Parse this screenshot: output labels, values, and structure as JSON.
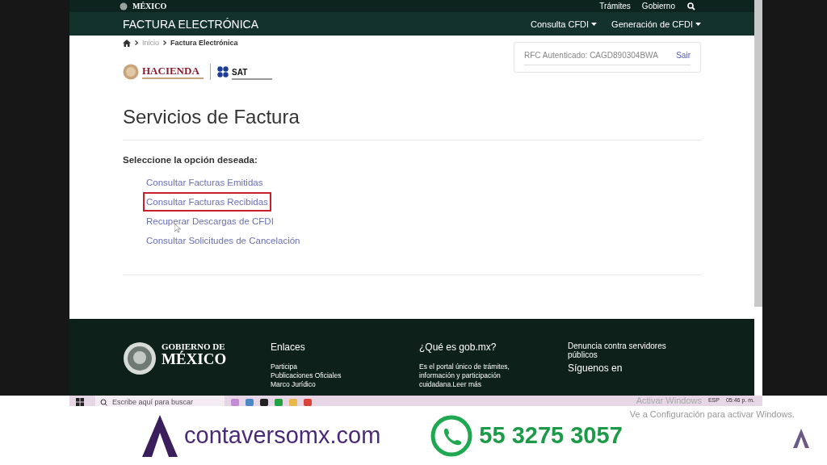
{
  "top_bar": {
    "logo": "MÉXICO",
    "links": [
      "Trámites",
      "Gobierno"
    ]
  },
  "nav_bar": {
    "title": "FACTURA ELECTRÓNICA",
    "menus": [
      "Consulta CFDI",
      "Generación de CFDI"
    ]
  },
  "breadcrumb": [
    "Inicio",
    "Factura Electrónica"
  ],
  "session": {
    "rfc": "RFC Autenticado: CAGD890304BWA",
    "logout": "Sair"
  },
  "logos": {
    "hacienda": "HACIENDA",
    "sat": "SAT"
  },
  "heading": "Servicios de Factura",
  "prompt": "Seleccione la opción deseada:",
  "options": [
    {
      "label": "Consultar Facturas Emitidas",
      "highlighted": false
    },
    {
      "label": "Consultar Facturas Recibidas",
      "highlighted": true
    },
    {
      "label": "Recuperar Descargas de CFDI",
      "highlighted": false
    },
    {
      "label": "Consultar Solicitudes de Cancelación",
      "highlighted": false
    }
  ],
  "footer": {
    "logo_line1": "GOBIERNO DE",
    "logo_line2": "MÉXICO",
    "columns": [
      {
        "title": "Enlaces",
        "lines": [
          "Participa",
          "Publicaciones Oficiales",
          "Marco Jurídico"
        ]
      },
      {
        "title": "¿Qué es gob.mx?",
        "lines": [
          "Es el portal único de trámites,",
          "información y participación",
          "cuidadana.Leer más"
        ]
      },
      {
        "title": "Denuncia contra servidores públicos",
        "subtitle": "Síguenos en"
      }
    ]
  },
  "taskbar": {
    "search_placeholder": "Escribe aquí para buscar",
    "language": "ESP",
    "time": "05:46 p. m.",
    "activation_title": "Activar Windows",
    "activation_text": "Ve a Configuración para activar Windows."
  },
  "banner": {
    "website": "contaversomx.com",
    "phone": "55 3275 3057"
  }
}
